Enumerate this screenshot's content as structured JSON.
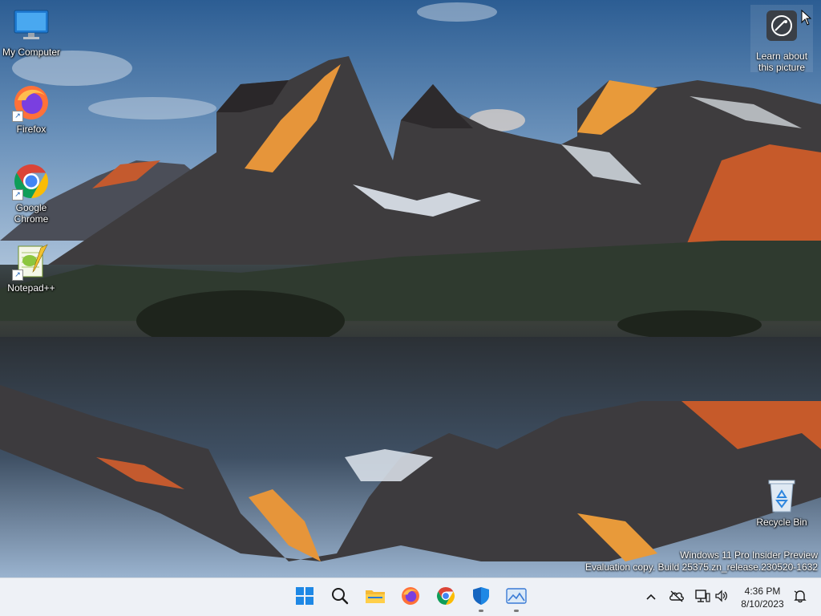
{
  "desktop_icons": [
    {
      "label": "My Computer",
      "icon": "monitor-icon",
      "shortcut": false
    },
    {
      "label": "Firefox",
      "icon": "firefox-icon",
      "shortcut": true
    },
    {
      "label": "Google Chrome",
      "icon": "chrome-icon",
      "shortcut": true
    },
    {
      "label": "Notepad++",
      "icon": "notepad-plus-plus-icon",
      "shortcut": true
    },
    {
      "label": "Recycle Bin",
      "icon": "recycle-bin-icon",
      "shortcut": false
    }
  ],
  "learn_widget": {
    "label": "Learn about this picture",
    "icon": "camera-info-icon"
  },
  "watermark": {
    "line1": "Windows 11 Pro Insider Preview",
    "line2": "Evaluation copy. Build 25375.zn_release.230520-1632"
  },
  "taskbar": {
    "apps": [
      {
        "name": "Start",
        "icon": "windows-start-icon",
        "running": false
      },
      {
        "name": "Search",
        "icon": "search-icon",
        "running": false
      },
      {
        "name": "File Explorer",
        "icon": "folder-icon",
        "running": false
      },
      {
        "name": "Firefox",
        "icon": "firefox-icon",
        "running": false
      },
      {
        "name": "Google Chrome",
        "icon": "chrome-icon",
        "running": false
      },
      {
        "name": "Windows Security",
        "icon": "shield-icon",
        "running": true
      },
      {
        "name": "Photos",
        "icon": "photos-icon",
        "running": true
      }
    ],
    "tray": {
      "icons": [
        "chevron-up-icon",
        "cloud-offline-icon",
        "network-icon",
        "volume-icon"
      ],
      "time": "4:36 PM",
      "date": "8/10/2023",
      "notification_icon": "notification-bell-icon"
    }
  },
  "colors": {
    "taskbar_bg": "#eef1f6",
    "accent": "#0078d4"
  }
}
